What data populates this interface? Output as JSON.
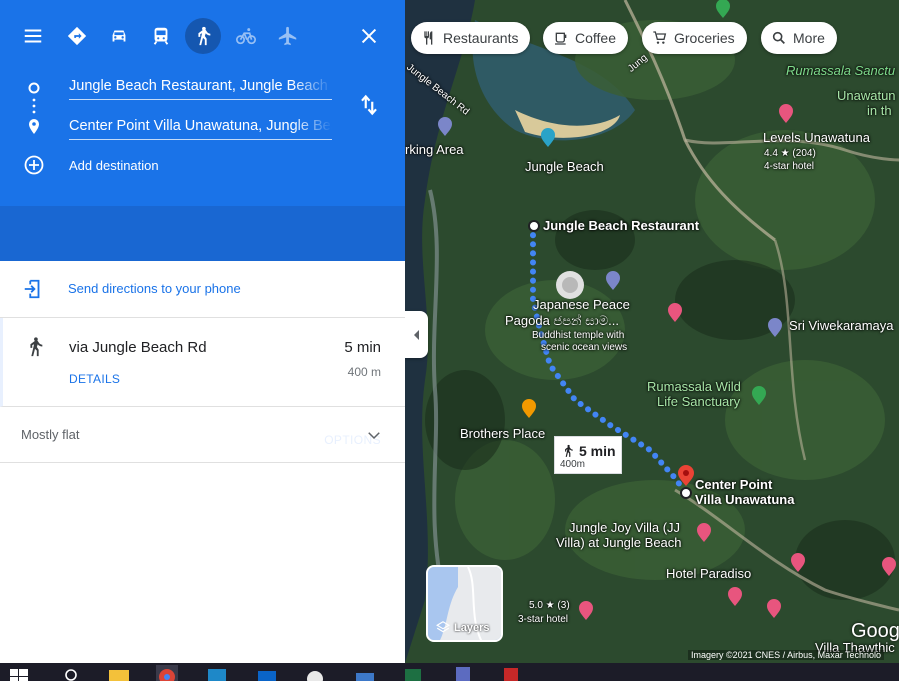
{
  "directions": {
    "origin": "Jungle Beach Restaurant, Jungle Beach",
    "destination": "Center Point Villa Unawatuna, Jungle Beach",
    "add_destination": "Add destination",
    "options": "OPTIONS",
    "send_to_phone": "Send directions to your phone",
    "route": {
      "via": "via Jungle Beach Rd",
      "time": "5 min",
      "distance": "400 m",
      "details": "DETAILS"
    },
    "elevation": "Mostly flat",
    "active_mode": "walking"
  },
  "map": {
    "chips": [
      {
        "label": "Restaurants",
        "icon": "fork-knife-icon"
      },
      {
        "label": "Coffee",
        "icon": "coffee-cup-icon"
      },
      {
        "label": "Groceries",
        "icon": "cart-icon"
      },
      {
        "label": "More",
        "icon": "search-icon"
      }
    ],
    "places": {
      "rumassala": "Rumassala Sanctu",
      "unawatuna": "Unawatun",
      "in_the": "in th",
      "levels": "Levels Unawatuna",
      "levels_rating": "4.4 ★ (204)",
      "levels_type": "4-star hotel",
      "parking": "rking Area",
      "jungle_beach": "Jungle Beach",
      "jungle_beach_rd": "Jungle Beach Rd",
      "jung": "Jung",
      "restaurant": "Jungle Beach Restaurant",
      "pagoda1": "Japanese Peace",
      "pagoda2": "Pagoda ජපන් සාම...",
      "pagoda3": "Buddhist temple with",
      "pagoda4": "scenic ocean views",
      "sri": "Sri Viwekaramaya",
      "wild1": "Rumassala Wild",
      "wild2": "Life Sanctuary",
      "brothers": "Brothers Place",
      "center1": "Center Point",
      "center2": "Villa Unawatuna",
      "joy1": "Jungle Joy Villa (JJ",
      "joy2": "Villa) at Jungle Beach",
      "paradiso": "Hotel Paradiso",
      "rating5": "5.0 ★ (3)",
      "star3": "3-star hotel",
      "villa_bottom": "Villa Thawthic"
    },
    "walk_box": {
      "time": "5 min",
      "distance": "400m"
    },
    "layers": "Layers",
    "google": "Goog",
    "imagery": "Imagery ©2021 CNES / Airbus, Maxar Technolo"
  },
  "colors": {
    "accent": "#1a73e8",
    "route": "#4285f4",
    "pin": "#ea4335"
  }
}
